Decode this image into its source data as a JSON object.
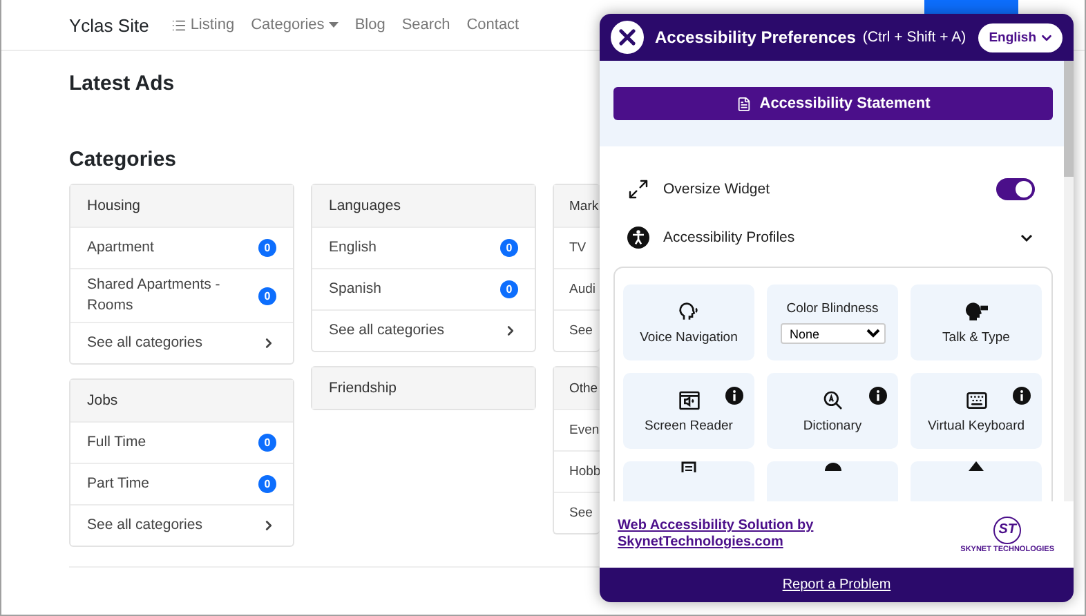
{
  "site": {
    "brand": "Yclas Site",
    "nav": [
      {
        "label": "Listing",
        "kind": "list"
      },
      {
        "label": "Categories",
        "kind": "dropdown"
      },
      {
        "label": "Blog",
        "kind": "plain"
      },
      {
        "label": "Search",
        "kind": "plain"
      },
      {
        "label": "Contact",
        "kind": "plain"
      }
    ]
  },
  "latest_heading": "Latest Ads",
  "categories_heading": "Categories",
  "category_columns": [
    [
      {
        "title": "Housing",
        "items": [
          {
            "label": "Apartment",
            "count": "0"
          },
          {
            "label": "Shared Apartments - Rooms",
            "count": "0"
          }
        ],
        "see_all": "See all categories"
      },
      {
        "title": "Jobs",
        "items": [
          {
            "label": "Full Time",
            "count": "0"
          },
          {
            "label": "Part Time",
            "count": "0"
          }
        ],
        "see_all": "See all categories"
      }
    ],
    [
      {
        "title": "Languages",
        "items": [
          {
            "label": "English",
            "count": "0"
          },
          {
            "label": "Spanish",
            "count": "0"
          }
        ],
        "see_all": "See all categories"
      },
      {
        "title": "Friendship"
      }
    ],
    [
      {
        "title": "Mark",
        "items": [
          {
            "label": "TV"
          },
          {
            "label": "Audi"
          }
        ],
        "see_all": "See"
      },
      {
        "title": "Othe",
        "items": [
          {
            "label": "Even"
          },
          {
            "label": "Hobb"
          }
        ],
        "see_all": "See"
      }
    ]
  ],
  "panel": {
    "title": "Accessibility Preferences",
    "shortcut": "(Ctrl + Shift + A)",
    "language": "English",
    "statement_button": "Accessibility Statement",
    "oversize": {
      "label": "Oversize Widget",
      "on": true
    },
    "profiles": {
      "label": "Accessibility Profiles",
      "expanded": false
    },
    "tiles": [
      {
        "kind": "tool",
        "label": "Voice Navigation",
        "info": false
      },
      {
        "kind": "select",
        "label": "Color Blindness",
        "value": "None"
      },
      {
        "kind": "tool",
        "label": "Talk & Type",
        "info": false
      },
      {
        "kind": "tool",
        "label": "Screen Reader",
        "info": true
      },
      {
        "kind": "tool",
        "label": "Dictionary",
        "info": true
      },
      {
        "kind": "tool",
        "label": "Virtual Keyboard",
        "info": true
      }
    ],
    "footer_link": "Web Accessibility Solution by SkynetTechnologies.com",
    "logo_mark": "ST",
    "logo_text": "SKYNET TECHNOLOGIES",
    "report": "Report a Problem"
  }
}
